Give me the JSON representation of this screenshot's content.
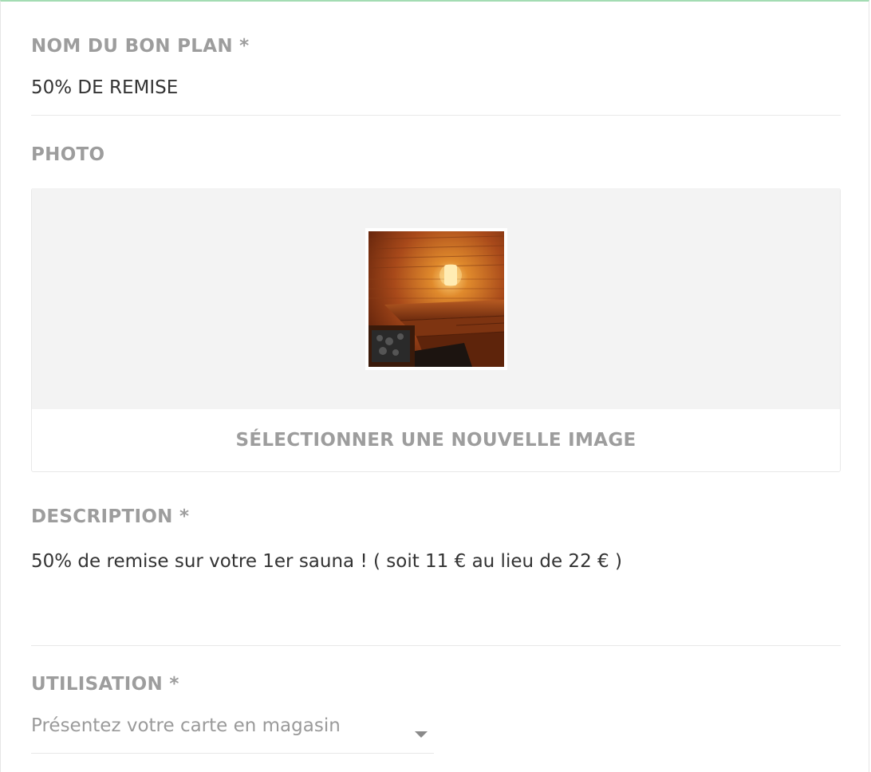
{
  "form": {
    "name": {
      "label": "NOM DU BON PLAN *",
      "value": "50% DE REMISE"
    },
    "photo": {
      "label": "PHOTO",
      "image_subject": "sauna interior",
      "select_button_label": "SÉLECTIONNER UNE NOUVELLE IMAGE"
    },
    "description": {
      "label": "DESCRIPTION *",
      "value": "50% de remise sur votre 1er sauna ! ( soit 11 € au lieu de 22 € )"
    },
    "usage": {
      "label": "UTILISATION *",
      "selected": "Présentez votre carte en magasin",
      "icon": "chevron-down-icon"
    }
  },
  "colors": {
    "top_accent": "#a3dcb3",
    "label": "#9d9d9d",
    "text": "#333333",
    "photo_background": "#f3f3f3"
  }
}
